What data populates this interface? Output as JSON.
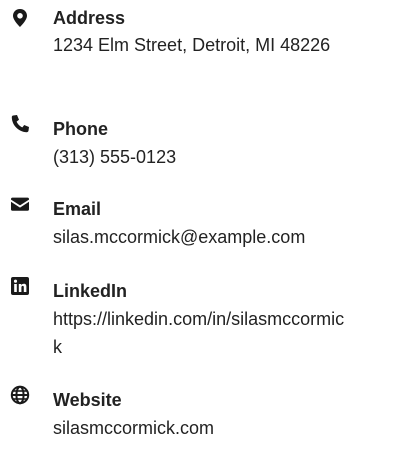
{
  "contact": {
    "address": {
      "icon": "map-marker-icon",
      "label": "Address",
      "value": "1234 Elm Street, Detroit, MI 48226"
    },
    "phone": {
      "icon": "phone-icon",
      "label": "Phone",
      "value": "(313) 555-0123"
    },
    "email": {
      "icon": "envelope-icon",
      "label": "Email",
      "value": "silas.mccormick@example.com"
    },
    "linkedin": {
      "icon": "linkedin-icon",
      "label": "LinkedIn",
      "value": "https://linkedin.com/in/silasmccormick"
    },
    "website": {
      "icon": "globe-icon",
      "label": "Website",
      "value": "silasmccormick.com"
    }
  },
  "colors": {
    "text": "#222222",
    "icon": "#1a1a1a"
  }
}
